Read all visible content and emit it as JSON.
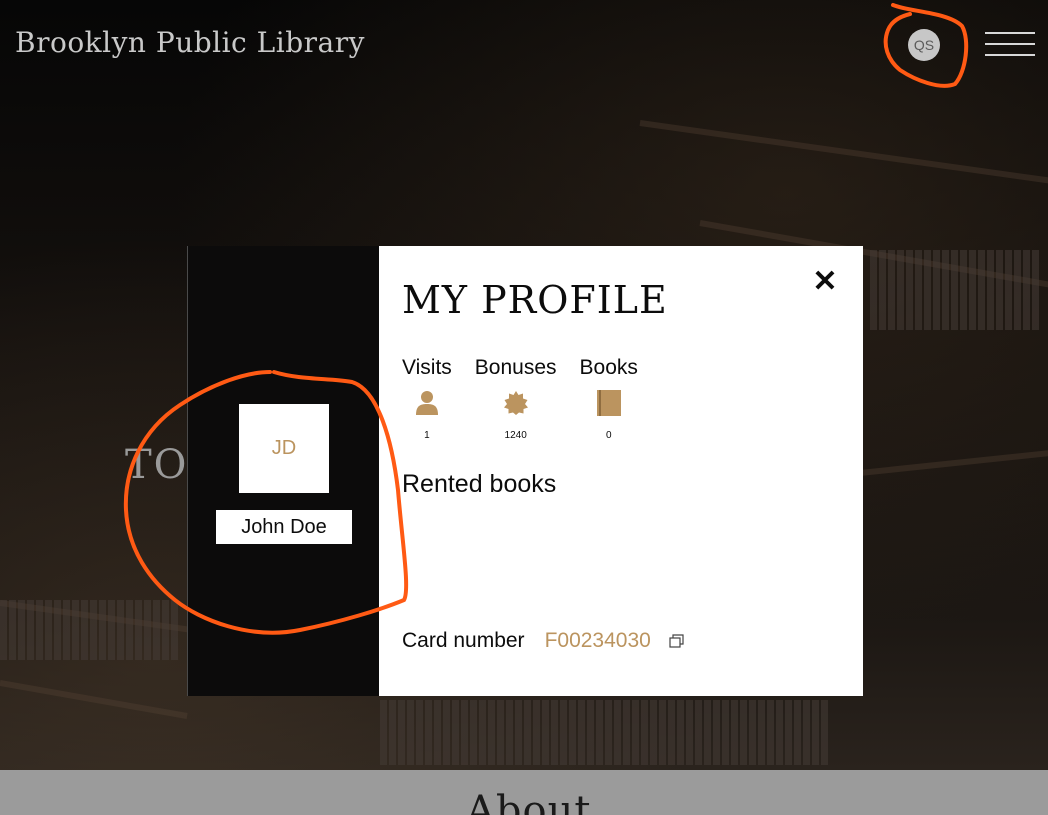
{
  "header": {
    "site_title": "Brooklyn Public Library",
    "avatar_initials": "QS"
  },
  "hero": {
    "visible_text": "TO"
  },
  "profile_modal": {
    "title": "MY PROFILE",
    "close_label": "✕",
    "user": {
      "initials": "JD",
      "name": "John Doe"
    },
    "stats": [
      {
        "label": "Visits",
        "icon": "person-icon",
        "value": "1"
      },
      {
        "label": "Bonuses",
        "icon": "badge-star-icon",
        "value": "1240"
      },
      {
        "label": "Books",
        "icon": "book-icon",
        "value": "0"
      }
    ],
    "rented_books_title": "Rented books",
    "card_number_label": "Card number",
    "card_number_value": "F00234030"
  },
  "about": {
    "title": "About"
  },
  "colors": {
    "accent_gold": "#bb945f",
    "annotation_orange": "#ff5a14",
    "modal_bg": "#ffffff",
    "dark_bg": "#0c0b0b"
  }
}
